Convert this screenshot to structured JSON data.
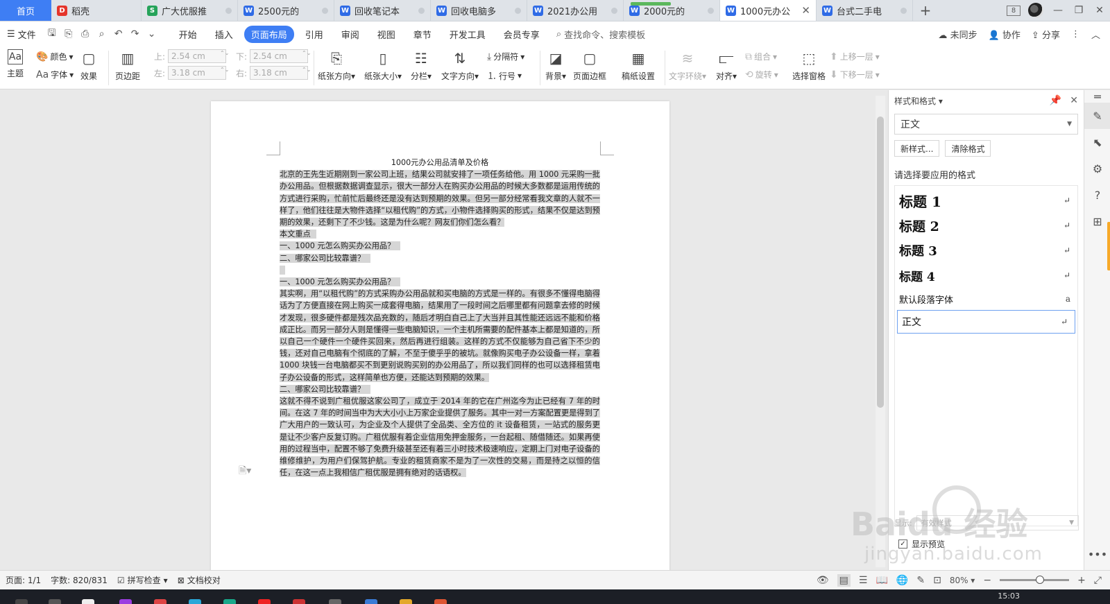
{
  "tabs": {
    "home": "首页",
    "items": [
      {
        "label": "稻壳",
        "icon": "r"
      },
      {
        "label": "广大优服推",
        "icon": "s"
      },
      {
        "label": "2500元的",
        "icon": "w"
      },
      {
        "label": "回收笔记本",
        "icon": "w"
      },
      {
        "label": "回收电脑多",
        "icon": "w"
      },
      {
        "label": "2021办公用",
        "icon": "w"
      },
      {
        "label": "2000元的",
        "icon": "w"
      },
      {
        "label": "1000元办公",
        "icon": "w"
      },
      {
        "label": "台式二手电",
        "icon": "w"
      }
    ],
    "active_index": 7,
    "badge": "8"
  },
  "menu": {
    "file": "文件",
    "tabs": [
      "开始",
      "插入",
      "页面布局",
      "引用",
      "审阅",
      "视图",
      "章节",
      "开发工具",
      "会员专享"
    ],
    "active_tab": "页面布局",
    "search": "查找命令、搜索模板",
    "sync": "未同步",
    "collab": "协作",
    "share": "分享"
  },
  "ribbon": {
    "theme": "主题",
    "color": "颜色",
    "font": "字体",
    "effect": "效果",
    "margins": "页边距",
    "top_label": "上:",
    "top_value": "2.54 cm",
    "bottom_label": "下:",
    "bottom_value": "2.54 cm",
    "left_label": "左:",
    "left_value": "3.18 cm",
    "right_label": "右:",
    "right_value": "3.18 cm",
    "orientation": "纸张方向",
    "size": "纸张大小",
    "columns": "分栏",
    "text_direction": "文字方向",
    "breaks": "分隔符",
    "line_numbers": "行号",
    "background": "背景",
    "page_border": "页面边框",
    "manuscript": "稿纸设置",
    "wrap": "文字环绕",
    "align": "对齐",
    "group": "组合",
    "rotate": "旋转",
    "selection_pane": "选择窗格",
    "bring_forward": "上移一层",
    "send_backward": "下移一层"
  },
  "document": {
    "title": "1000元办公用品清单及价格",
    "paragraphs": [
      "北京的王先生近期刚到一家公司上班，结果公司就安排了一项任务给他。用 1000 元采购一批办公用品。但根据数据调查显示，很大一部分人在购买办公用品的时候大多数都是运用传统的方式进行采购，忙前忙后最终还是没有达到预期的效果。但另一部分经常看我文章的人就不一样了，他们往往是大物件选择“以租代购”的方式，小物件选择购买的形式，结果不仅是达到预期的效果，还剩下了不少钱。这是为什么呢？网友们你们怎么看？",
      "本文重点",
      "一、1000 元怎么购买办公用品？",
      "二、哪家公司比较靠谱？",
      " ",
      "一、1000 元怎么购买办公用品？",
      "其实啊，用“以租代购”的方式采购办公用品就和买电脑的方式是一样的。有很多不懂得电脑得话为了方便直接在网上购买一成套得电脑，结果用了一段时间之后哪里都有问题拿去修的时候才发现，很多硬件都是残次品充数的，随后才明白自己上了大当并且其性能还远远不能和价格成正比。而另一部分人则是懂得一些电脑知识，一个主机所需要的配件基本上都是知道的，所以自己一个硬件一个硬件买回来，然后再进行组装。这样的方式不仅能够为自己省下不少的钱，还对自己电脑有个彻底的了解，不至于傻乎乎的被坑。就像购买电子办公设备一样，拿着 1000 块钱一台电脑都买不到更别说购买别的办公用品了，所以我们同样的也可以选择租赁电子办公设备的形式，这样简单也方便，还能达到预期的效果。",
      "二、哪家公司比较靠谱？",
      "这就不得不说到广租优服这家公司了，成立于 2014 年的它在广州迄今为止已经有 7 年的时间。在这 7 年的时间当中为大大小小上万家企业提供了服务。其中一对一方案配置更是得到了广大用户的一致认可，为企业及个人提供了全品类、全方位的 it 设备租赁，一站式的服务更是让不少客户反复订购。广租优服有着企业信用免押金服务，一台起租、随借随还。如果再使用的过程当中，配置不够了免费升级甚至还有着三小时技术极速响应，定期上门对电子设备的维修维护，为用户们保驾护航。专业的租赁商家不是为了一次性的交易，而是持之以恒的信任，在这一点上我相信广租优服是拥有绝对的话语权。"
    ]
  },
  "panel": {
    "title": "样式和格式",
    "current_style": "正文",
    "new_style": "新样式...",
    "clear_format": "清除格式",
    "choose_label": "请选择要应用的格式",
    "styles": [
      "标题 1",
      "标题 2",
      "标题 3",
      "标题 4",
      "默认段落字体",
      "正文"
    ],
    "show_label": "显示:",
    "show_value": "有效样式",
    "preview": "显示预览"
  },
  "status": {
    "page": "页面: 1/1",
    "words": "字数: 820/831",
    "spell": "拼写检查",
    "proof": "文档校对",
    "zoom": "80%"
  },
  "taskbar": {
    "time": "15:03"
  },
  "watermark": {
    "brand": "Baidu 经验",
    "url": "jingyan.baidu.com"
  }
}
